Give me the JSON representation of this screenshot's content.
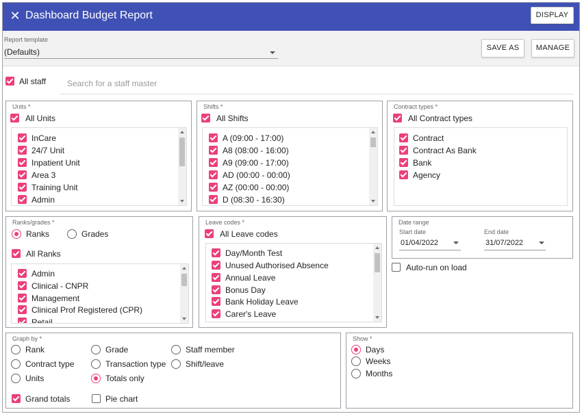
{
  "header": {
    "title": "Dashboard Budget Report",
    "display_label": "DISPLAY",
    "close_glyph": "✕"
  },
  "toolbar": {
    "template_label": "Report template",
    "template_value": "(Defaults)",
    "save_as_label": "SAVE AS",
    "manage_label": "MANAGE"
  },
  "staff": {
    "all_staff_label": "All staff",
    "search_placeholder": "Search for a staff master"
  },
  "units": {
    "title": "Units *",
    "all_label": "All Units",
    "items": [
      "InCare",
      "24/7 Unit",
      "Inpatient Unit",
      "Area 3",
      "Training Unit",
      "Admin"
    ]
  },
  "shifts": {
    "title": "Shifts *",
    "all_label": "All Shifts",
    "items": [
      "A (09:00 - 17:00)",
      "A8 (08:00 - 16:00)",
      "A9 (09:00 - 17:00)",
      "AD (00:00 - 00:00)",
      "AZ (00:00 - 00:00)",
      "D (08:30 - 16:30)"
    ]
  },
  "contract_types": {
    "title": "Contract types *",
    "all_label": "All Contract types",
    "items": [
      "Contract",
      "Contract As Bank",
      "Bank",
      "Agency"
    ]
  },
  "ranks": {
    "title": "Ranks/grades *",
    "ranks_label": "Ranks",
    "grades_label": "Grades",
    "all_label": "All Ranks",
    "items": [
      "Admin",
      "Clinical - CNPR",
      "Management",
      "Clinical Prof Registered (CPR)",
      "Retail"
    ]
  },
  "leave_codes": {
    "title": "Leave codes *",
    "all_label": "All Leave codes",
    "items": [
      "Day/Month Test",
      "Unused Authorised Absence",
      "Annual Leave",
      "Bonus Day",
      "Bank Holiday Leave",
      "Carer's Leave"
    ]
  },
  "date_range": {
    "title": "Date range",
    "start_label": "Start date",
    "start_value": "01/04/2022",
    "end_label": "End date",
    "end_value": "31/07/2022",
    "auto_run_label": "Auto-run on load"
  },
  "graph_by": {
    "title": "Graph by *",
    "options": [
      "Rank",
      "Grade",
      "Staff member",
      "Contract type",
      "Transaction type",
      "Shift/leave",
      "Units",
      "Totals only"
    ],
    "selected": "Totals only",
    "grand_totals_label": "Grand totals",
    "pie_chart_label": "Pie chart"
  },
  "show": {
    "title": "Show *",
    "options": [
      "Days",
      "Weeks",
      "Months"
    ],
    "selected": "Days"
  },
  "colors": {
    "header": "#3f51b5",
    "accent": "#ec407a"
  }
}
